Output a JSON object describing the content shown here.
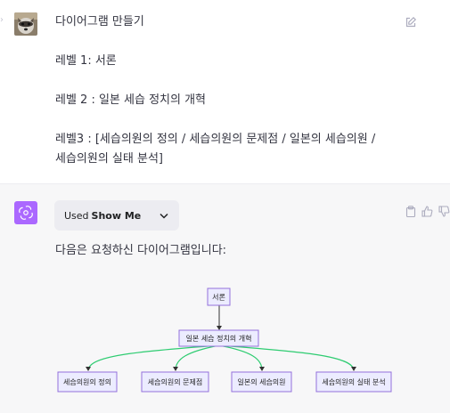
{
  "user_message": {
    "lines": [
      "다이어그램 만들기",
      "",
      "레벨 1: 서론",
      "",
      "레벨 2 : 일본 세습 정치의 개혁",
      "",
      "레벨3 : [세습의원의 정의 / 세습의원의 문제점 / 일본의 세습의원 /",
      "세습의원의 실태 분석]"
    ]
  },
  "icons": {
    "user_avatar": "raccoon-avatar-icon",
    "edit": "edit-icon",
    "assistant_avatar": "openai-logo-icon",
    "chevron": "chevron-down-icon",
    "copy": "clipboard-icon",
    "like": "thumbs-up-icon",
    "dislike": "thumbs-down-icon"
  },
  "assistant": {
    "plugin_used_prefix": "Used",
    "plugin_name": "Show Me",
    "answer_text": "다음은 요청하신 다이어그램입니다:"
  },
  "diagram": {
    "root": "서론",
    "level2": "일본 세습 정치의 개혁",
    "level3": [
      "세습의원의 정의",
      "세습의원의 문제점",
      "일본의 세습의원",
      "세습의원의 실태 분석"
    ],
    "colors": {
      "node_fill": "#ececff",
      "node_border": "#9370db",
      "edge_root": "#333333",
      "edge_children": "#2ecc71"
    }
  },
  "colors": {
    "assistant_avatar_bg": "#ab68ff",
    "assistant_bg": "#f7f7f8",
    "chip_bg": "#ececf1",
    "text": "#343541"
  }
}
